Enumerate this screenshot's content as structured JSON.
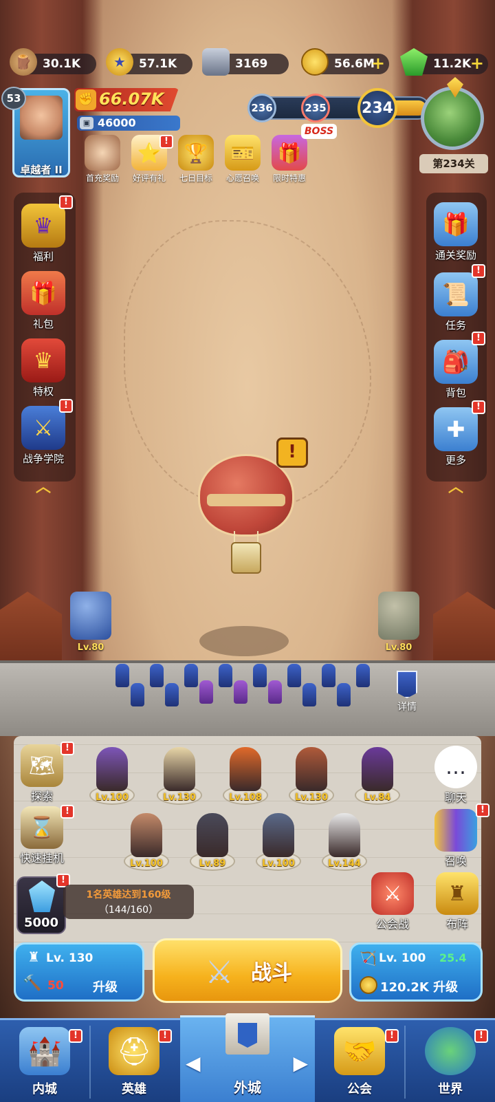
{
  "resources": {
    "wood": "30.1K",
    "badge": "57.1K",
    "iron": "3169",
    "gold": "56.6M",
    "gems": "11.2K",
    "plus": "+"
  },
  "player": {
    "level": "53",
    "name": "卓越者 II",
    "power": "66.07K",
    "sub_power": "46000"
  },
  "events": [
    {
      "label": "首充奖励",
      "icon": "first-recharge-icon"
    },
    {
      "label": "好评有礼",
      "icon": "review-gift-icon"
    },
    {
      "label": "七日目标",
      "icon": "seven-day-trophy-icon"
    },
    {
      "label": "心愿召唤",
      "icon": "wish-summon-icon"
    },
    {
      "label": "限时特惠",
      "icon": "limited-offer-icon"
    }
  ],
  "stage": {
    "node_next2": "236",
    "node_next1": "235",
    "boss_tag": "BOSS",
    "current": "234",
    "label": "第234关"
  },
  "left_menu": [
    {
      "label": "福利",
      "icon": "welfare-crown-icon"
    },
    {
      "label": "礼包",
      "icon": "gift-pack-icon"
    },
    {
      "label": "特权",
      "icon": "privilege-crown-icon"
    },
    {
      "label": "战争学院",
      "icon": "war-academy-icon"
    }
  ],
  "right_menu": [
    {
      "label": "通关奖励",
      "icon": "clear-reward-icon"
    },
    {
      "label": "任务",
      "icon": "task-scroll-icon"
    },
    {
      "label": "背包",
      "icon": "backpack-icon"
    },
    {
      "label": "更多",
      "icon": "more-dpad-icon"
    }
  ],
  "alert_mark": "!",
  "turrets": {
    "left_lv": "Lv.80",
    "right_lv": "Lv.80"
  },
  "detail_label": "详情",
  "heroes": [
    {
      "lv": "Lv.100",
      "color": "#7d55b8"
    },
    {
      "lv": "Lv.130",
      "color": "#e8d6a8"
    },
    {
      "lv": "Lv.108",
      "color": "#e06a2a"
    },
    {
      "lv": "Lv.130",
      "color": "#b05a3a"
    },
    {
      "lv": "Lv.84",
      "color": "#6a3a9a"
    },
    {
      "lv": "Lv.100",
      "color": "#c48a6a"
    },
    {
      "lv": "Lv.89",
      "color": "#4a4a5a"
    },
    {
      "lv": "Lv.100",
      "color": "#5a6a8a"
    },
    {
      "lv": "Lv.144",
      "color": "#e8e8e8"
    }
  ],
  "yard_left": [
    {
      "label": "探索",
      "icon": "explore-map-icon"
    },
    {
      "label": "快速挂机",
      "icon": "hourglass-icon"
    }
  ],
  "yard_right": [
    {
      "label": "聊天",
      "icon": "chat-bubble-icon"
    },
    {
      "label": "召唤",
      "icon": "summon-cards-icon"
    },
    {
      "label": "公会战",
      "icon": "guild-war-icon"
    },
    {
      "label": "布阵",
      "icon": "formation-rook-icon"
    }
  ],
  "quest": {
    "line1": "1名英雄达到160级",
    "line2": "（144/160）"
  },
  "gem_reward": "5000",
  "castle_upgrade": {
    "level": "Lv. 130",
    "cost": "50",
    "action": "升级"
  },
  "fight_label": "战斗",
  "tower_upgrade": {
    "level": "Lv. 100",
    "atk": "25.4",
    "cost": "120.2K 升级"
  },
  "nav": {
    "inner_city": "内城",
    "heroes": "英雄",
    "outer_city": "外城",
    "guild": "公会",
    "world": "世界",
    "prev": "◀",
    "next": "▶"
  },
  "colors": {
    "accent_gold": "#f6b21d",
    "nav_blue": "#2e5fae",
    "alert_red": "#e3352a",
    "power_red": "#c0302a"
  }
}
